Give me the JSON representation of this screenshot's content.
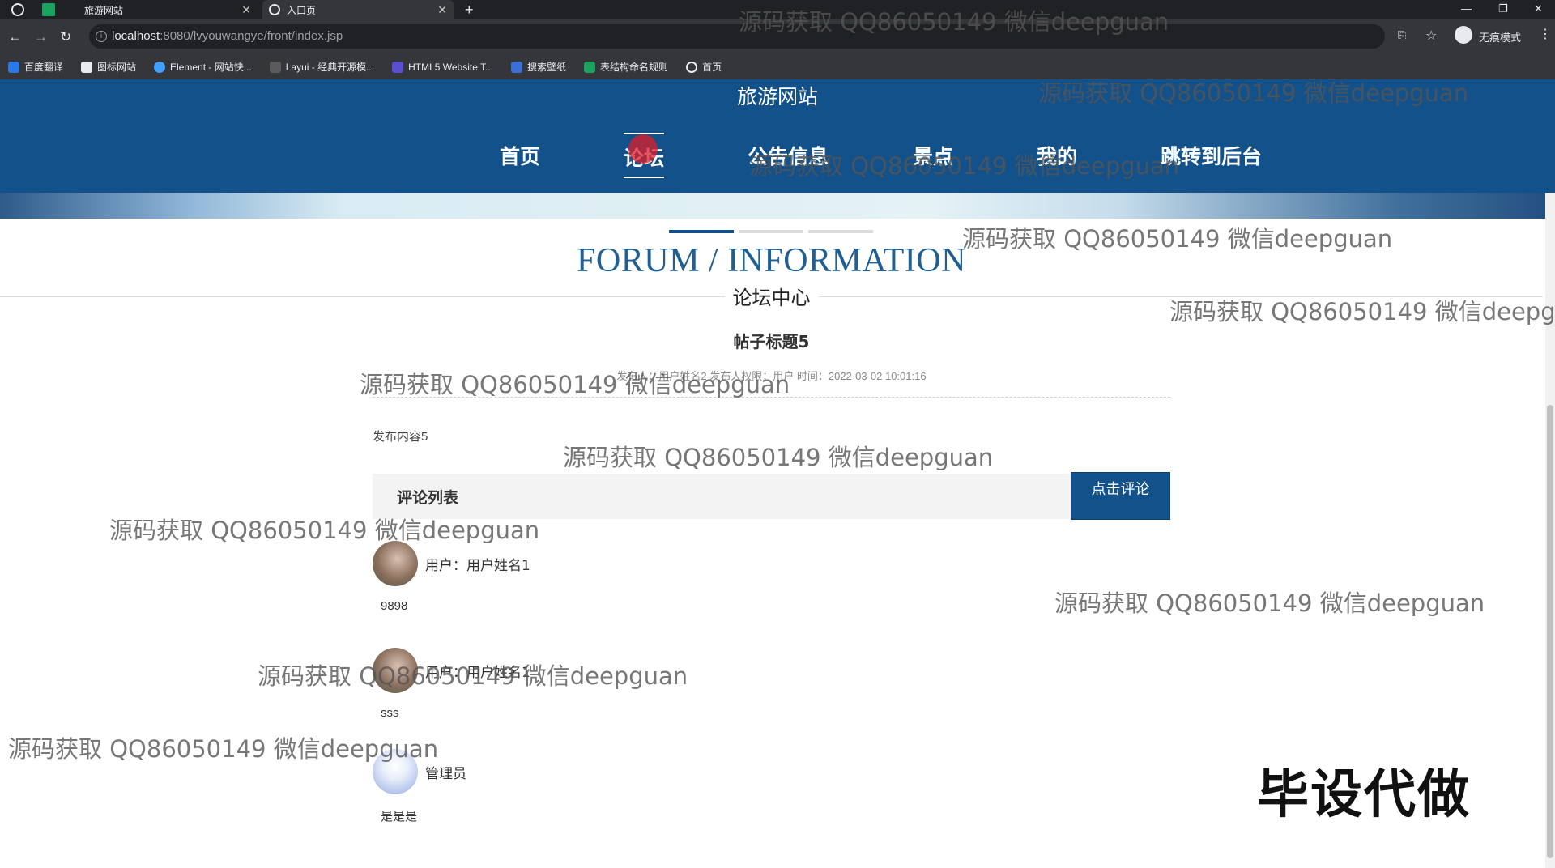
{
  "browser": {
    "tabs": [
      {
        "title": "旅游网站"
      },
      {
        "title": "入口页"
      }
    ],
    "url_host": "localhost",
    "url_path": ":8080/lvyouwangye/front/index.jsp",
    "profile_label": "无痕模式",
    "bookmarks": [
      "百度翻译",
      "图标网站",
      "Element - 网站快...",
      "Layui - 经典开源模...",
      "HTML5 Website T...",
      "搜索壁纸",
      "表结构命名规则",
      "首页"
    ]
  },
  "site": {
    "title": "旅游网站",
    "nav": [
      "首页",
      "论坛",
      "公告信息",
      "景点",
      "我的",
      "跳转到后台"
    ],
    "active_nav": "论坛"
  },
  "section": {
    "title": "FORUM / INFORMATION",
    "subtitle": "论坛中心"
  },
  "post": {
    "title": "帖子标题5",
    "meta": "发布人：用户姓名2   发布人权限：用户   时间：2022-03-02 10:01:16",
    "content": "发布内容5"
  },
  "comments_section": {
    "heading": "评论列表",
    "button": "点击评论"
  },
  "comments": [
    {
      "user": "用户：用户姓名1",
      "text": "9898"
    },
    {
      "user": "用户：用户姓名1",
      "text": "sss"
    },
    {
      "user": "管理员",
      "text": "是是是"
    }
  ],
  "watermarks": [
    "源码获取 QQ86050149 微信deepguan",
    "源码获取 QQ86050149 微信deepguan",
    "源码获取 QQ86050149 微信deepguan",
    "源码获取 QQ86050149 微信deepguan",
    "源码获取 QQ86050149 微信deepg",
    "源码获取 QQ86050149 微信deepguan",
    "源码获取 QQ86050149 微信deepguan",
    "源码获取 QQ86050149 微信deepguan",
    "源码获取 QQ86050149 微信deepguan",
    "源码获取 QQ86050149 微信deepguan",
    "源码获取 QQ86050149 微信deepguan"
  ],
  "stamp": "毕设代做",
  "colors": {
    "primary": "#13518a",
    "title_blue": "#1f5f94",
    "indicator_active": "#13518a",
    "indicator_inactive": "#dcdcdc"
  }
}
